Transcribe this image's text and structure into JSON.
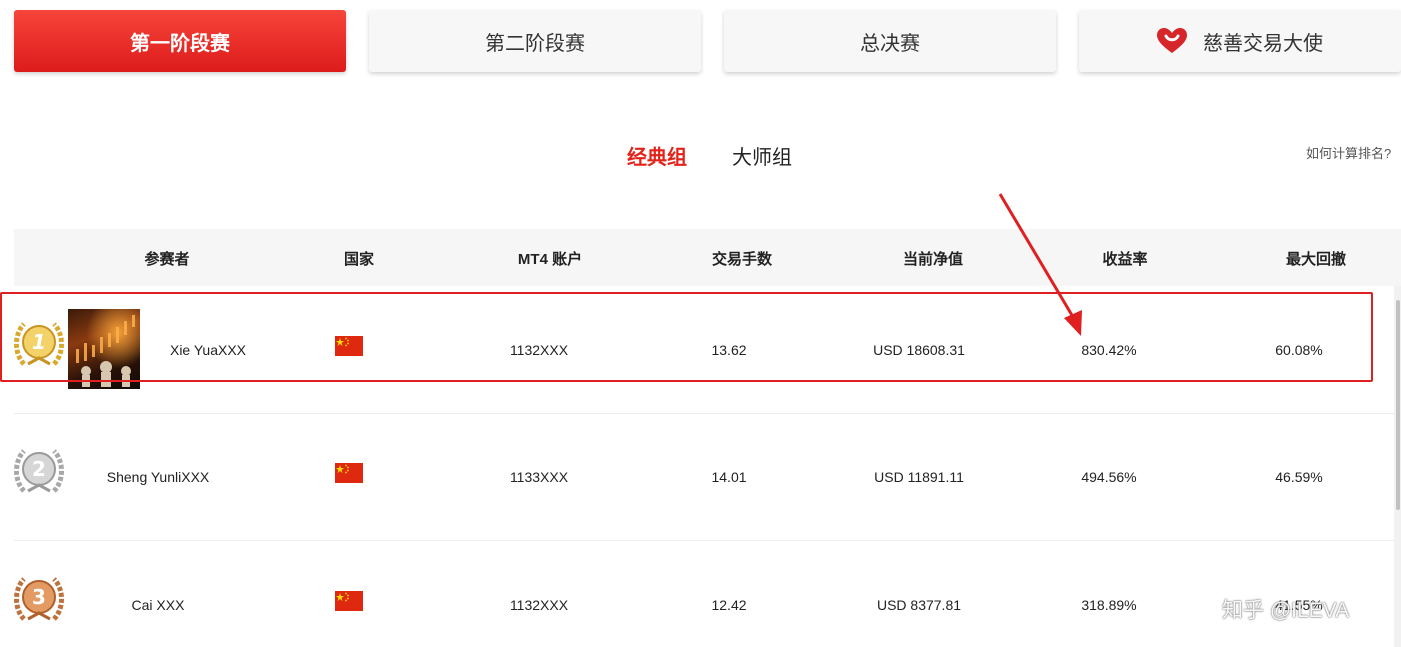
{
  "stage_tabs": [
    {
      "label": "第一阶段赛",
      "active": true
    },
    {
      "label": "第二阶段赛",
      "active": false
    },
    {
      "label": "总决赛",
      "active": false
    },
    {
      "label": "慈善交易大使",
      "active": false,
      "icon": "heart-icon"
    }
  ],
  "group_tabs": [
    {
      "label": "经典组",
      "active": true
    },
    {
      "label": "大师组",
      "active": false
    }
  ],
  "help_link": "如何计算排名?",
  "table": {
    "headers": {
      "participant": "参赛者",
      "country": "国家",
      "account": "MT4 账户",
      "lots": "交易手数",
      "equity": "当前净值",
      "return": "收益率",
      "drawdown": "最大回撤"
    },
    "rows": [
      {
        "rank": "1",
        "name": "Xie YuaXXX",
        "country": "China",
        "account": "1132XXX",
        "lots": "13.62",
        "equity": "USD 18608.31",
        "return": "830.42%",
        "drawdown": "60.08%"
      },
      {
        "rank": "2",
        "name": "Sheng YunliXXX",
        "country": "China",
        "account": "1133XXX",
        "lots": "14.01",
        "equity": "USD 11891.11",
        "return": "494.56%",
        "drawdown": "46.59%"
      },
      {
        "rank": "3",
        "name": "Cai XXX",
        "country": "China",
        "account": "1132XXX",
        "lots": "12.42",
        "equity": "USD 8377.81",
        "return": "318.89%",
        "drawdown": "41.55%"
      }
    ]
  },
  "watermark": "知乎 @ILEVA",
  "colors": {
    "accent": "#e2231a",
    "gold": "#d9a82e",
    "silver": "#a8a8a8",
    "bronze": "#c0703a",
    "annotation": "#e02020"
  }
}
